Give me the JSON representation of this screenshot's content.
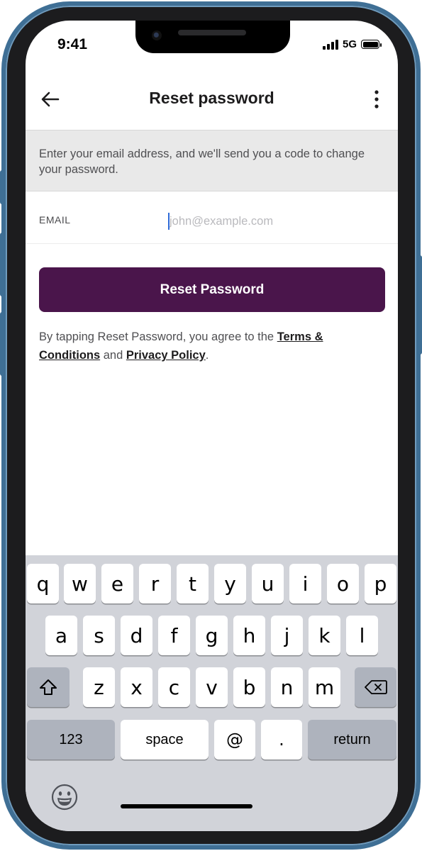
{
  "status_bar": {
    "time": "9:41",
    "network": "5G"
  },
  "header": {
    "title": "Reset password"
  },
  "info": {
    "text": "Enter your email address, and we'll send you a code to change your password."
  },
  "email": {
    "label": "EMAIL",
    "placeholder": "john@example.com",
    "value": ""
  },
  "reset_button": {
    "label": "Reset Password"
  },
  "terms": {
    "prefix": "By tapping Reset Password, you agree to the ",
    "terms_link": "Terms & Conditions",
    "middle": " and ",
    "privacy_link": "Privacy Policy",
    "suffix": "."
  },
  "keyboard": {
    "row1": [
      "q",
      "w",
      "e",
      "r",
      "t",
      "y",
      "u",
      "i",
      "o",
      "p"
    ],
    "row2": [
      "a",
      "s",
      "d",
      "f",
      "g",
      "h",
      "j",
      "k",
      "l"
    ],
    "row3": [
      "z",
      "x",
      "c",
      "v",
      "b",
      "n",
      "m"
    ],
    "numbers_label": "123",
    "space_label": "space",
    "at_label": "@",
    "dot_label": ".",
    "return_label": "return"
  },
  "colors": {
    "accent": "#4a154b",
    "caret": "#2f6bd8",
    "frame": "#3f6f95"
  },
  "icons": [
    "back-arrow-icon",
    "more-vertical-icon",
    "shift-icon",
    "backspace-icon",
    "emoji-icon"
  ]
}
